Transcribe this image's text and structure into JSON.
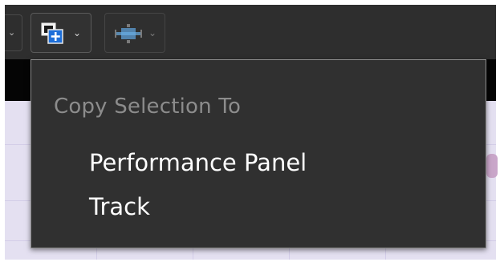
{
  "toolbar": {
    "buttons": [
      {
        "name": "copy-selection-button",
        "icon": "copy-add-icon",
        "has_dropdown": true
      },
      {
        "name": "zoom-fit-button",
        "icon": "zoom-to-fit-icon",
        "has_dropdown": true,
        "disabled": true
      }
    ]
  },
  "menu": {
    "header": "Copy Selection To",
    "items": [
      {
        "label": "Performance Panel"
      },
      {
        "label": "Track"
      }
    ]
  },
  "colors": {
    "toolbar_bg": "#2e2e2e",
    "menu_bg": "#303030",
    "menu_border": "#8d8d8d",
    "header_text": "#8c8c8c",
    "item_text": "#ffffff",
    "accent": "#1e6fd9"
  }
}
